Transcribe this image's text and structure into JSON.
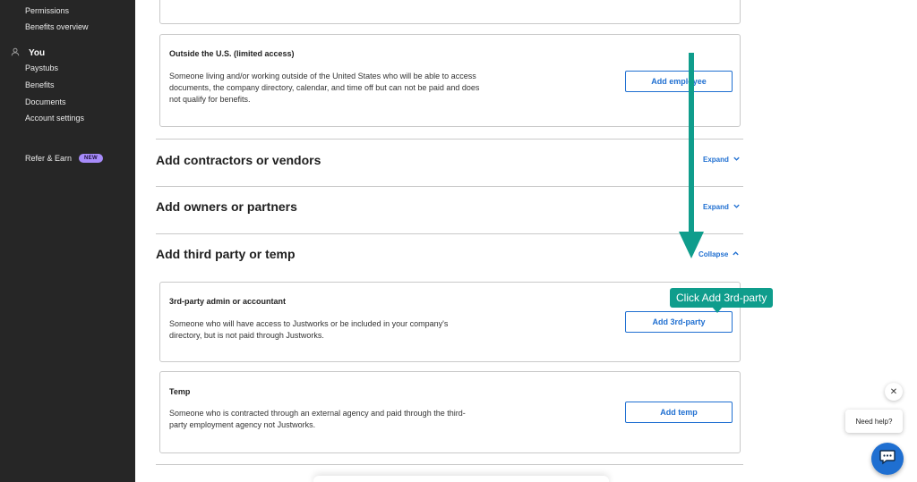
{
  "sidebar": {
    "top_items": [
      {
        "label": "Permissions"
      },
      {
        "label": "Benefits overview"
      }
    ],
    "section_you": {
      "label": "You",
      "icon": "user-icon"
    },
    "you_items": [
      {
        "label": "Paystubs"
      },
      {
        "label": "Benefits"
      },
      {
        "label": "Documents"
      },
      {
        "label": "Account settings"
      }
    ],
    "refer": {
      "label": "Refer & Earn",
      "badge": "NEW"
    }
  },
  "cards": {
    "outside_us": {
      "title": "Outside the U.S. (limited access)",
      "description": "Someone living and/or working outside of the United States who will be able to access documents, the company directory, calendar, and time off but can not be paid and does not qualify for benefits.",
      "button": "Add employee"
    },
    "third_party_admin": {
      "title": "3rd-party admin or accountant",
      "description": "Someone who will have access to Justworks or be included in your company's directory, but is not paid through Justworks.",
      "button": "Add 3rd-party"
    },
    "temp": {
      "title": "Temp",
      "description": "Someone who is contracted through an external agency and paid through the third-party employment agency not Justworks.",
      "button": "Add temp"
    }
  },
  "sections": {
    "contractors": {
      "title": "Add contractors or vendors",
      "toggle": "Expand"
    },
    "owners": {
      "title": "Add owners or partners",
      "toggle": "Expand"
    },
    "third_party": {
      "title": "Add third party or temp",
      "toggle": "Collapse"
    }
  },
  "annotation": {
    "callout": "Click Add 3rd-party",
    "color": "#0f9d8c"
  },
  "help": {
    "bubble": "Need help?",
    "close": "✕"
  },
  "colors": {
    "accent": "#1f6fd1",
    "sidebar_bg": "#262626",
    "badge": "#a78bfa"
  }
}
